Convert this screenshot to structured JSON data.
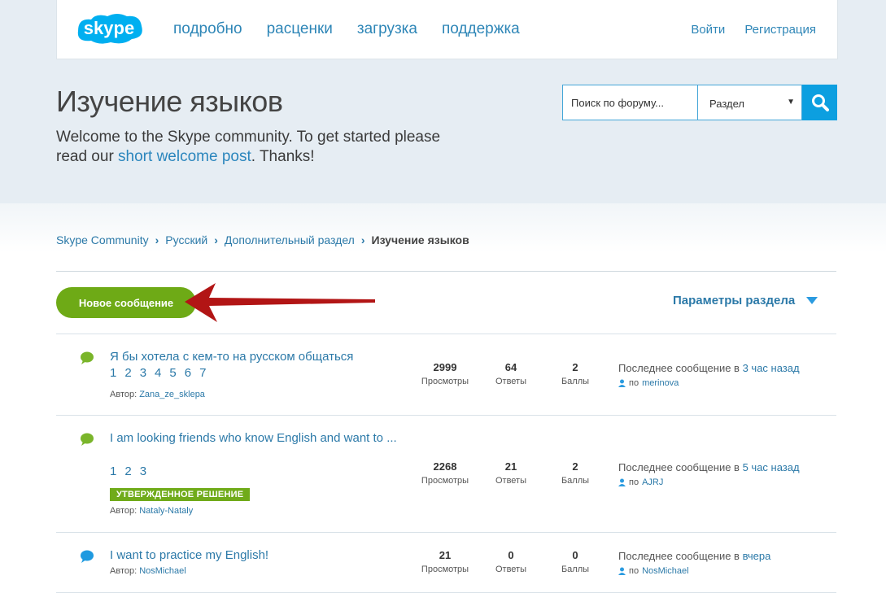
{
  "nav": {
    "items": [
      "подробно",
      "расценки",
      "загрузка",
      "поддержка"
    ],
    "login": "Войти",
    "register": "Регистрация"
  },
  "hero": {
    "title": "Изучение языков",
    "text_before": "Welcome to the Skype community. To get started please read our ",
    "link": "short welcome post",
    "text_after": ". Thanks!"
  },
  "search": {
    "placeholder": "Поиск по форуму...",
    "scope": "Раздел"
  },
  "breadcrumb": [
    "Skype Community",
    "Русский",
    "Дополнительный раздел",
    "Изучение языков"
  ],
  "actions": {
    "new_post": "Новое сообщение",
    "section_params": "Параметры раздела"
  },
  "labels": {
    "views": "Просмотры",
    "replies": "Ответы",
    "kudos": "Баллы",
    "last_post": "Последнее сообщение в ",
    "by": "по ",
    "author": "Автор: "
  },
  "topics": [
    {
      "title": "Я бы хотела с кем-то на русском общаться",
      "pages": [
        "1",
        "2",
        "3",
        "4",
        "5",
        "6",
        "7"
      ],
      "author": "Zana_ze_sklepa",
      "views": "2999",
      "replies": "64",
      "kudos": "2",
      "last_time": "3 час назад",
      "last_user": "merinova",
      "solved": ""
    },
    {
      "title": "I am looking friends who know English and want to ...",
      "pages": [
        "1",
        "2",
        "3"
      ],
      "author": "Nataly-Nataly",
      "views": "2268",
      "replies": "21",
      "kudos": "2",
      "last_time": "5 час назад",
      "last_user": "AJRJ",
      "solved": "УТВЕРЖДЕННОЕ РЕШЕНИЕ"
    },
    {
      "title": "I want to practice my English!",
      "pages": [],
      "author": "NosMichael",
      "views": "21",
      "replies": "0",
      "kudos": "0",
      "last_time": "вчера",
      "last_user": "NosMichael",
      "solved": ""
    }
  ],
  "colors": {
    "brand_blue": "#0c9fe0",
    "green": "#6eaa16",
    "link": "#2b79a8"
  }
}
